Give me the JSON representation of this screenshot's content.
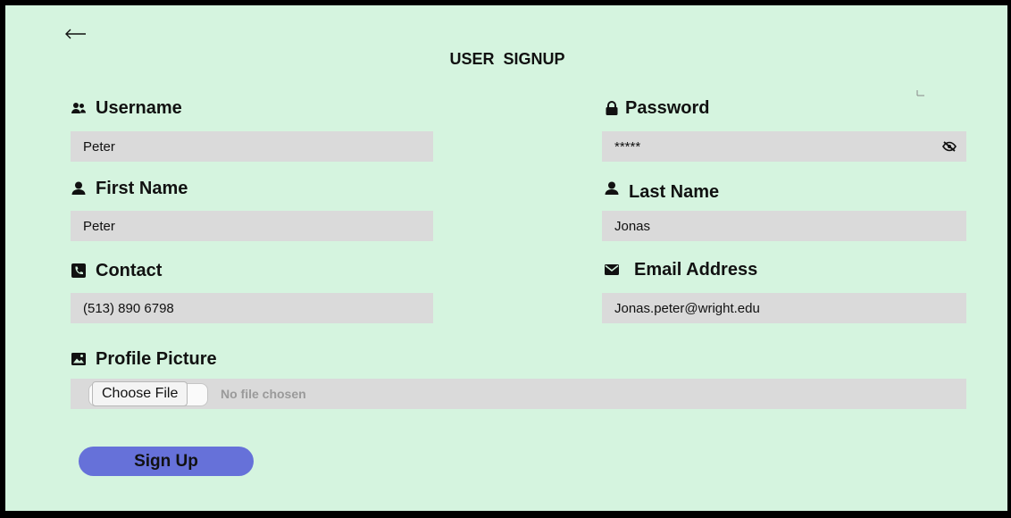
{
  "header": {
    "back_icon": "arrow-left-icon",
    "title": "USER  SIGNUP"
  },
  "fields": {
    "username": {
      "label": "Username",
      "icon": "users-icon",
      "value": "Peter"
    },
    "password": {
      "label": "Password",
      "icon": "lock-icon",
      "value": "*****",
      "toggle_icon": "eye-slash-icon"
    },
    "first_name": {
      "label": "First Name",
      "icon": "user-icon",
      "value": "Peter"
    },
    "last_name": {
      "label": "Last Name",
      "icon": "user-icon",
      "value": "Jonas"
    },
    "contact": {
      "label": "Contact",
      "icon": "phone-icon",
      "value": "(513) 890 6798"
    },
    "email": {
      "label": "Email Address",
      "icon": "envelope-icon",
      "value": "Jonas.peter@wright.edu"
    },
    "profile_picture": {
      "label": "Profile Picture",
      "icon": "image-icon",
      "button_label": "Choose File",
      "status": "No file chosen"
    }
  },
  "actions": {
    "signup_label": "Sign Up"
  },
  "colors": {
    "background": "#d5f4df",
    "field": "#dadada",
    "button": "#6671d9",
    "frame": "#000000"
  }
}
